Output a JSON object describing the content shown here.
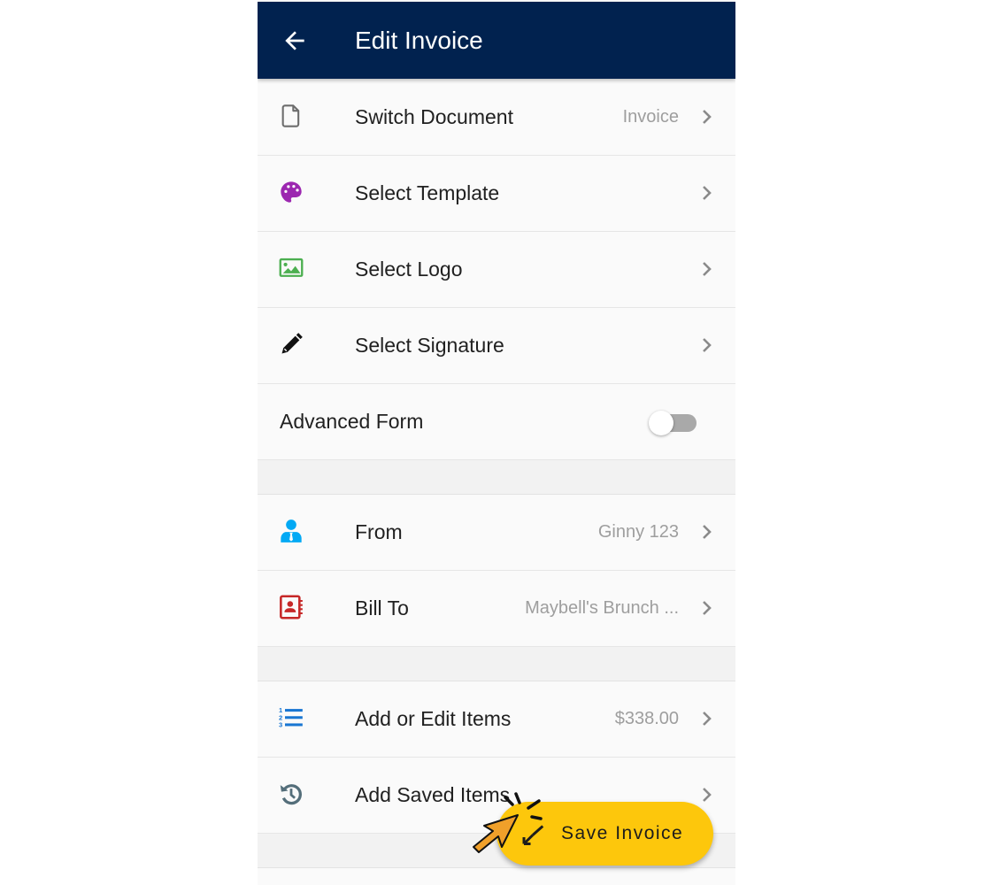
{
  "appbar": {
    "title": "Edit Invoice",
    "back_icon": "arrow-left-icon"
  },
  "colors": {
    "appbar": "#01224f",
    "fab": "#fdc70c",
    "template_icon": "#9c27b0",
    "logo_icon": "#4caf50",
    "from_icon": "#03a9f4",
    "billto_icon": "#c62828",
    "items_icon": "#1976d2",
    "saved_icon": "#546e7a"
  },
  "menu": {
    "switch_document": {
      "label": "Switch Document",
      "value": "Invoice",
      "icon": "document-icon"
    },
    "select_template": {
      "label": "Select Template",
      "icon": "palette-icon"
    },
    "select_logo": {
      "label": "Select Logo",
      "icon": "image-icon"
    },
    "select_signature": {
      "label": "Select Signature",
      "icon": "pencil-icon"
    },
    "advanced_form": {
      "label": "Advanced Form",
      "enabled": false
    },
    "from": {
      "label": "From",
      "value": "Ginny 123",
      "icon": "person-icon"
    },
    "bill_to": {
      "label": "Bill To",
      "value": "Maybell's Brunch ...",
      "icon": "contact-book-icon"
    },
    "items": {
      "label": "Add or Edit Items",
      "value": "$338.00",
      "icon": "numbered-list-icon"
    },
    "saved_items": {
      "label": "Add Saved Items",
      "icon": "history-icon"
    }
  },
  "fab": {
    "label": "Save Invoice",
    "icon": "save-icon"
  }
}
